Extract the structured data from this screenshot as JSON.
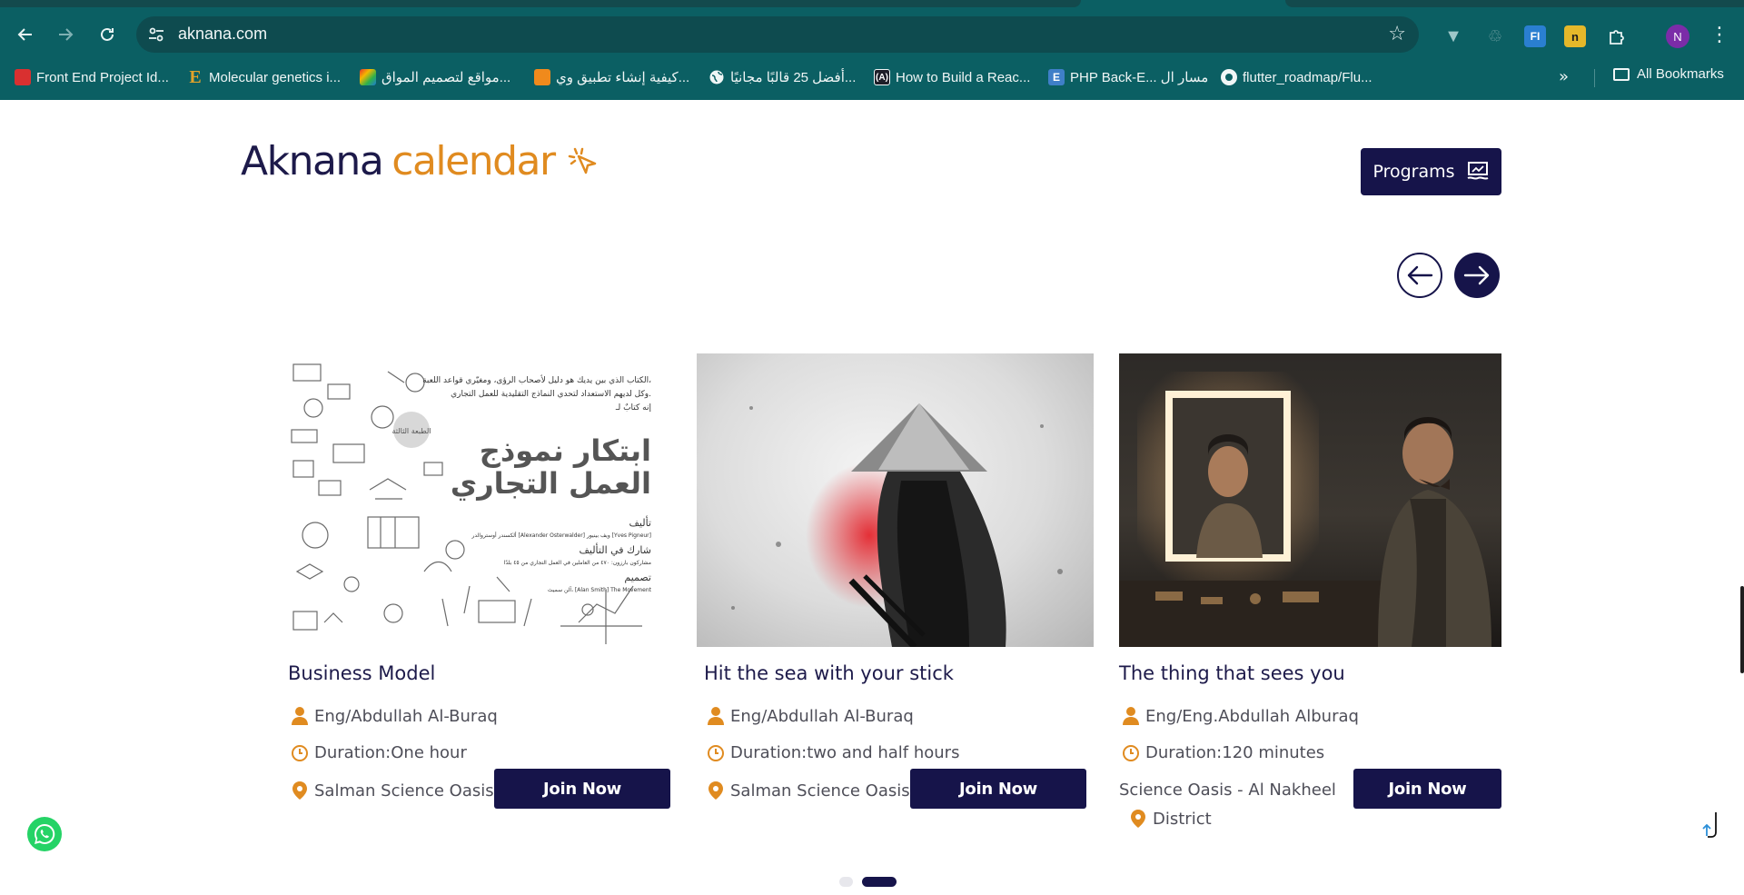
{
  "browser": {
    "url": "aknana.com",
    "avatar_letter": "N",
    "bookmarks": [
      {
        "label": "Front End Project Id...",
        "icon": "red-bookmark-icon"
      },
      {
        "label": "Molecular genetics i...",
        "icon": "e-letter-icon"
      },
      {
        "label": "مواقع لتصميم المواق...",
        "icon": "colorful-logo-icon"
      },
      {
        "label": "كيفية إنشاء تطبيق وي...",
        "icon": "orange-cube-icon"
      },
      {
        "label": "أفضل 25 قالبًا مجانيًا...",
        "icon": "globe-icon"
      },
      {
        "label": "How to Build a Reac...",
        "icon": "dev-logo-icon"
      },
      {
        "label": "PHP Back-E... مسار ال",
        "icon": "e-blue-icon"
      },
      {
        "label": "flutter_roadmap/Flu...",
        "icon": "github-icon"
      }
    ],
    "all_bookmarks_label": "All Bookmarks",
    "extensions": {
      "fi_label": "FI",
      "n_label": "n"
    }
  },
  "header": {
    "logo_part1": "Aknana",
    "logo_part2": "calendar",
    "programs_label": "Programs"
  },
  "cards": [
    {
      "title": "Business Model",
      "instructor": "Eng/Abdullah Al-Buraq",
      "duration": "Duration:One hour",
      "location": "Salman Science Oasis",
      "join_label": "Join Now",
      "image": {
        "line1": "الكتاب الذي بين يديك هو دليل لأصحاب الرؤى، ومغيّري قواعد اللعبة،",
        "line2": "وكل لديهم الاستعداد لتحدي النماذج التقليدية للعمل التجاري.",
        "line3": "إنه كتابٌ لـ",
        "badge": "الطبعة الثالثة",
        "title1": "ابتكار نموذج",
        "title2": "العمل التجاري",
        "authors_heading": "تأليف",
        "authors_line": "ألكسندر أوستروالدر [Alexander Osterwalder] ويف بينيور [Yves Pigneur]",
        "contrib_heading": "شارك في التأليف",
        "contrib_line": "مشاركون بارزون: ٤٧٠ من العاملين في العمل التجاري من ٤٥ بلدًا",
        "design_heading": "تصميم",
        "design_line": "آلن سميث، [Alan Smith] The Movement"
      }
    },
    {
      "title": "Hit the sea with your stick",
      "instructor": "Eng/Abdullah Al-Buraq",
      "duration": "Duration:two and half hours",
      "location": "Salman Science Oasis",
      "join_label": "Join Now"
    },
    {
      "title": "The thing that sees you",
      "instructor": "Eng/Eng.Abdullah Alburaq",
      "duration": "Duration:120 minutes",
      "location_line1": "Science Oasis - Al Nakheel",
      "location_line2": "District",
      "join_label": "Join Now"
    }
  ],
  "carousel": {
    "page_count": 2,
    "active_page": 2
  },
  "colors": {
    "brand_navy": "#16144a",
    "brand_orange": "#e08b20",
    "chrome_teal": "#0b5f63"
  }
}
